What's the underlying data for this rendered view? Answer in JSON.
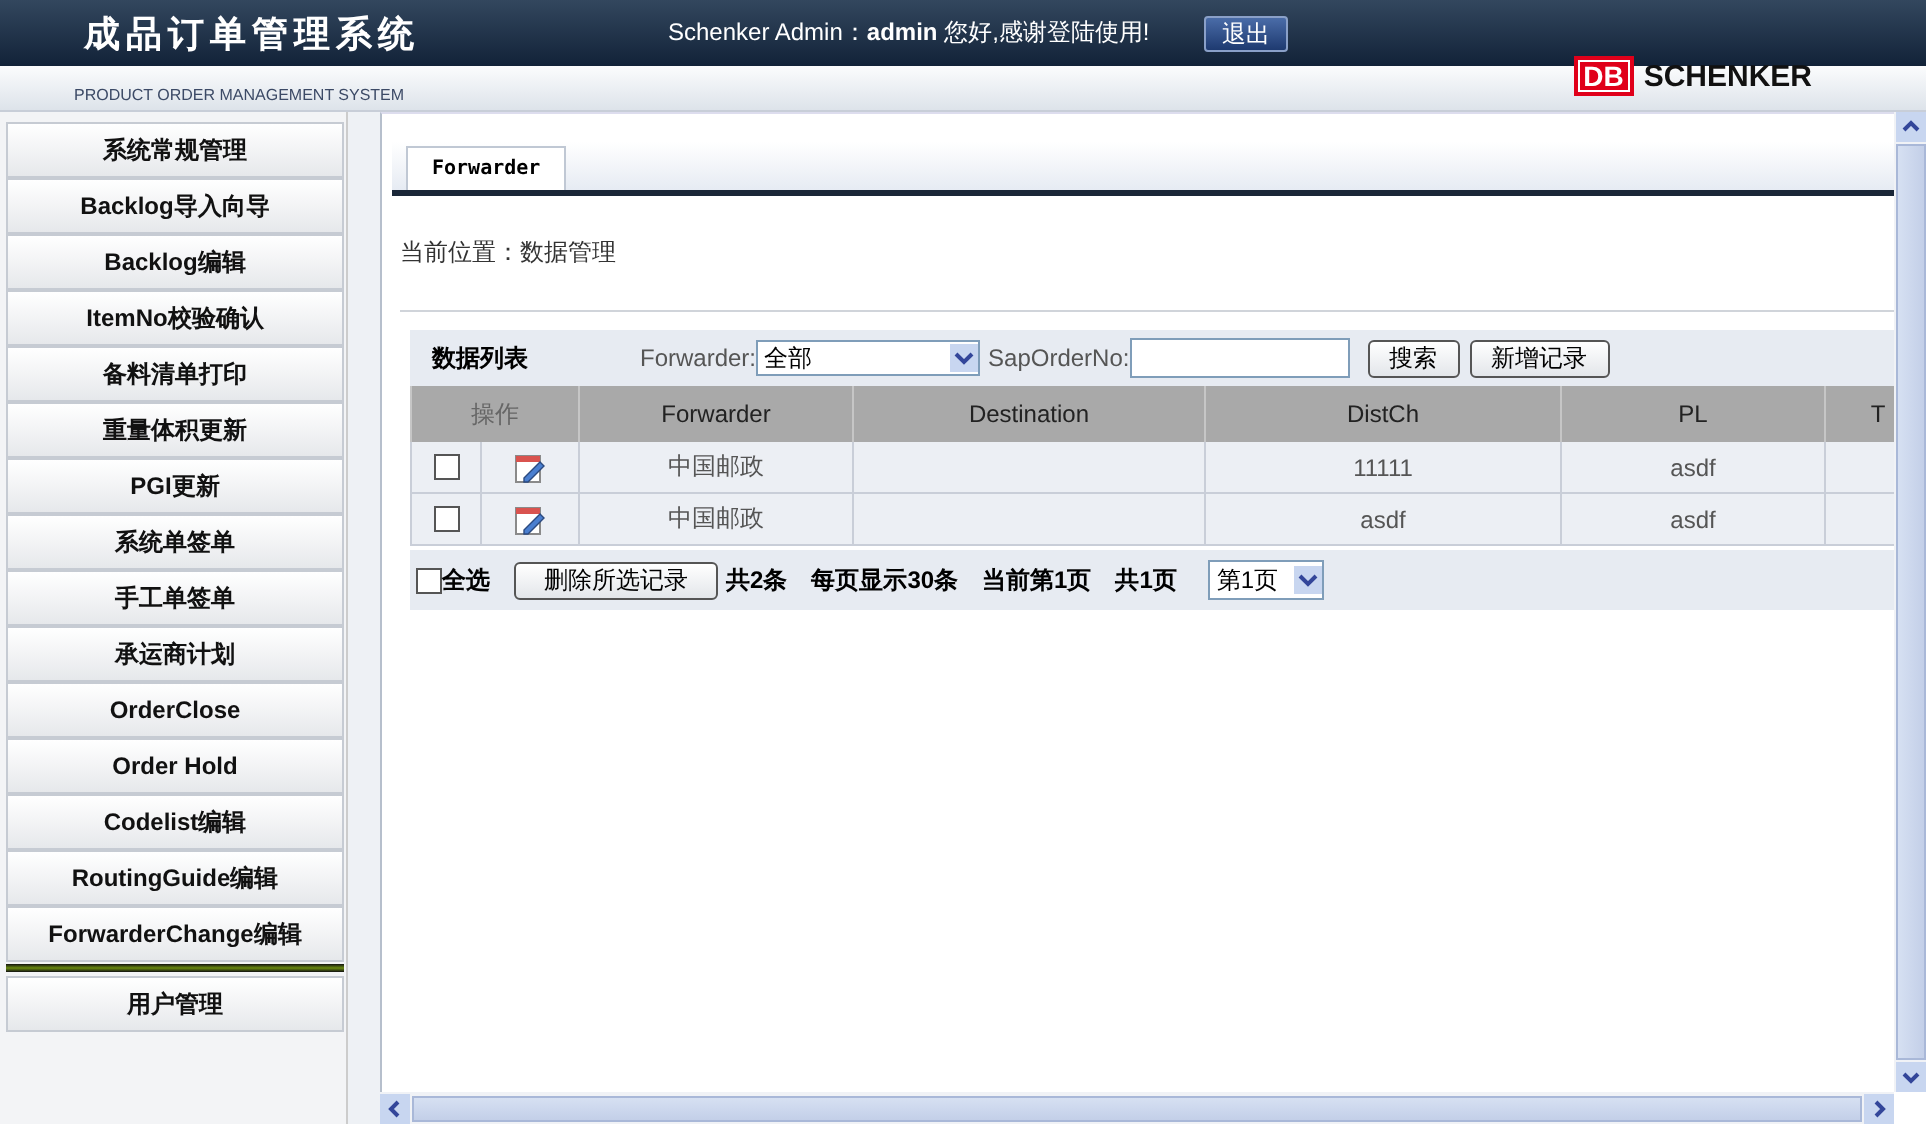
{
  "header": {
    "title": "成品订单管理系统",
    "subtitle": "PRODUCT ORDER MANAGEMENT SYSTEM",
    "greeting_prefix": "Schenker Admin：",
    "user": "admin",
    "greeting_suffix": "您好,感谢登陆使用!",
    "logout": "退出",
    "logo_mark": "DB",
    "logo_text": "SCHENKER"
  },
  "sidebar": {
    "items": [
      {
        "label": "系统常规管理"
      },
      {
        "label": "Backlog导入向导"
      },
      {
        "label": "Backlog编辑"
      },
      {
        "label": "ItemNo校验确认"
      },
      {
        "label": "备料清单打印"
      },
      {
        "label": "重量体积更新"
      },
      {
        "label": "PGI更新"
      },
      {
        "label": "系统单签单"
      },
      {
        "label": "手工单签单"
      },
      {
        "label": "承运商计划"
      },
      {
        "label": "OrderClose"
      },
      {
        "label": "Order Hold"
      },
      {
        "label": "Codelist编辑"
      },
      {
        "label": "RoutingGuide编辑"
      },
      {
        "label": "ForwarderChange编辑"
      }
    ],
    "footer_items": [
      {
        "label": "用户管理"
      }
    ]
  },
  "tabs": [
    {
      "label": "Forwarder",
      "selected": true
    }
  ],
  "breadcrumb": "当前位置：数据管理",
  "toolbar": {
    "title": "数据列表",
    "forwarder_label": "Forwarder:",
    "forwarder_value": "全部",
    "sap_label": "SapOrderNo:",
    "search": "搜索",
    "add": "新增记录"
  },
  "table": {
    "columns": [
      "操作",
      "Forwarder",
      "Destination",
      "DistCh",
      "PL",
      "T"
    ],
    "rows": [
      {
        "cells": [
          {
            "kind": "actions",
            "checked": false
          },
          {
            "kind": "text",
            "text": "中国邮政"
          },
          {
            "kind": "text",
            "text": ""
          },
          {
            "kind": "text",
            "text": "11111"
          },
          {
            "kind": "text",
            "text": "asdf"
          },
          {
            "kind": "text",
            "text": ""
          }
        ]
      },
      {
        "cells": [
          {
            "kind": "actions",
            "checked": false
          },
          {
            "kind": "text",
            "text": "中国邮政"
          },
          {
            "kind": "text",
            "text": ""
          },
          {
            "kind": "text",
            "text": "asdf"
          },
          {
            "kind": "text",
            "text": "asdf"
          },
          {
            "kind": "text",
            "text": ""
          }
        ]
      }
    ]
  },
  "footer": {
    "select_all": "全选",
    "select_all_checked": false,
    "delete": "删除所选记录",
    "total": "共2条",
    "per_page": "每页显示30条",
    "current": "当前第1页",
    "pages": "共1页",
    "page_select": "第1页"
  }
}
